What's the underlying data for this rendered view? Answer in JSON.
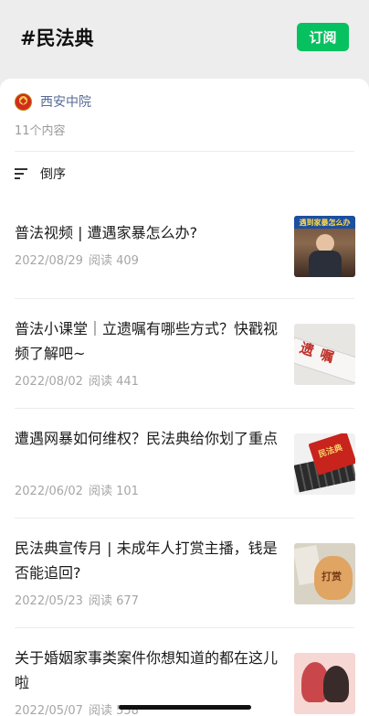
{
  "header": {
    "title": "#民法典",
    "subscribe_label": "订阅"
  },
  "source": {
    "name": "西安中院",
    "count": "11个内容"
  },
  "sort": {
    "label": "倒序"
  },
  "articles": [
    {
      "title": "普法视频 | 遭遇家暴怎么办?",
      "date": "2022/08/29",
      "reads": "阅读 409",
      "thumb_text": "遇到家暴怎么办"
    },
    {
      "title": "普法小课堂｜立遗嘱有哪些方式？快戳视频了解吧~",
      "date": "2022/08/02",
      "reads": "阅读 441",
      "thumb_text": "遗嘱"
    },
    {
      "title": "遭遇网暴如何维权？民法典给你划了重点",
      "date": "2022/06/02",
      "reads": "阅读 101",
      "thumb_text": "民法典"
    },
    {
      "title": "民法典宣传月 | 未成年人打赏主播，钱是否能追回?",
      "date": "2022/05/23",
      "reads": "阅读 677",
      "thumb_text": "打赏"
    },
    {
      "title": "关于婚姻家事类案件你想知道的都在这儿啦",
      "date": "2022/05/07",
      "reads": "阅读 558",
      "thumb_text": ""
    }
  ]
}
